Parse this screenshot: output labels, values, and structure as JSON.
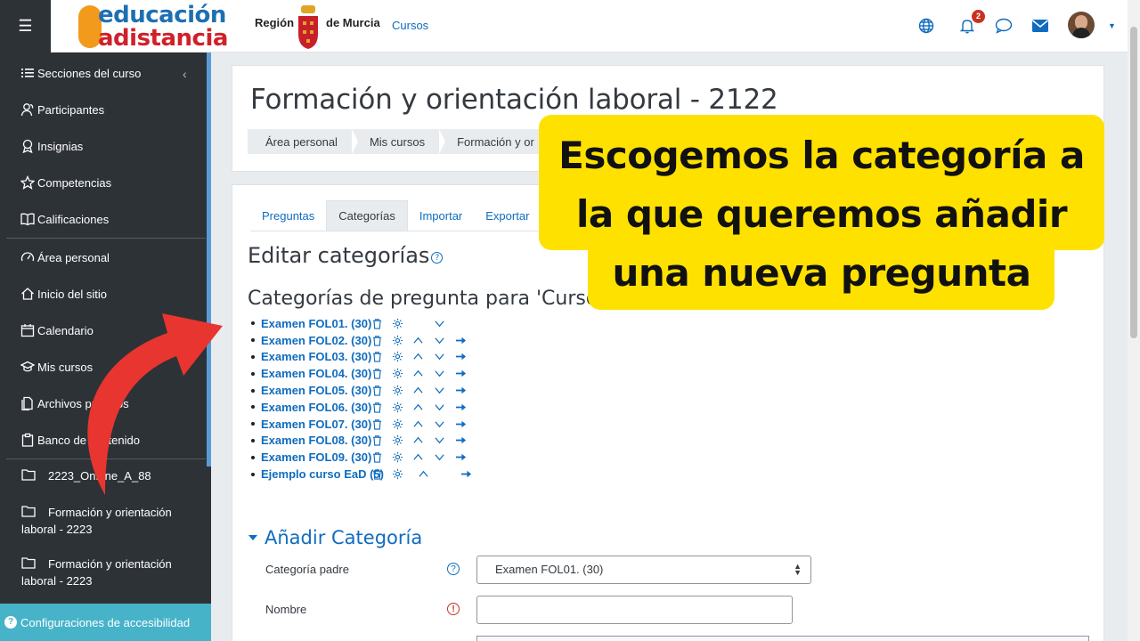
{
  "topbar": {
    "menu_icon": "hamburger-icon",
    "logo_line1": "educación",
    "logo_line2": "adistancia",
    "region_text": "Región",
    "murcia_text": "de Murcia",
    "cursos_link": "Cursos",
    "notification_count": "2",
    "icons": [
      "globe-icon",
      "bell-icon",
      "chat-icon",
      "envelope-icon"
    ]
  },
  "sidebar": {
    "items": [
      {
        "label": "Secciones del curso",
        "icon": "list-icon"
      },
      {
        "label": "Participantes",
        "icon": "users-icon"
      },
      {
        "label": "Insignias",
        "icon": "badge-icon"
      },
      {
        "label": "Competencias",
        "icon": "star-icon"
      },
      {
        "label": "Calificaciones",
        "icon": "gradebook-icon"
      },
      {
        "label": "Área personal",
        "icon": "dashboard-icon"
      },
      {
        "label": "Inicio del sitio",
        "icon": "home-icon"
      },
      {
        "label": "Calendario",
        "icon": "calendar-icon"
      },
      {
        "label": "Mis cursos",
        "icon": "graduation-icon"
      },
      {
        "label": "Archivos privados",
        "icon": "files-icon"
      },
      {
        "label": "Banco de contenido",
        "icon": "clipboard-icon"
      }
    ],
    "courses": [
      {
        "label": "2223_OnLine_A_88"
      },
      {
        "label": "Formación y orientación laboral - 2223"
      },
      {
        "label": "Formación y orientación laboral - 2223"
      }
    ],
    "accessibility": "Configuraciones de accesibilidad"
  },
  "header": {
    "title": "Formación y orientación laboral - 2122",
    "breadcrumb": [
      "Área personal",
      "Mis cursos",
      "Formación y or"
    ]
  },
  "tabs": [
    "Preguntas",
    "Categorías",
    "Importar",
    "Exportar"
  ],
  "main": {
    "edit_heading": "Editar categorías",
    "categories_heading": "Categorías de pregunta para 'Curso: Formación y",
    "categories": [
      {
        "name": "Examen FOL01. (30)"
      },
      {
        "name": "Examen FOL02. (30)"
      },
      {
        "name": "Examen FOL03. (30)"
      },
      {
        "name": "Examen FOL04. (30)"
      },
      {
        "name": "Examen FOL05. (30)"
      },
      {
        "name": "Examen FOL06. (30)"
      },
      {
        "name": "Examen FOL07. (30)"
      },
      {
        "name": "Examen FOL08. (30)"
      },
      {
        "name": "Examen FOL09. (30)"
      },
      {
        "name": "Ejemplo curso EaD (5)"
      }
    ],
    "add_heading": "Añadir Categoría",
    "parent_label": "Categoría padre",
    "parent_value": "Examen FOL01. (30)",
    "name_label": "Nombre"
  },
  "callout": {
    "line1": "Escogemos la categoría a",
    "line2": "la que queremos añadir",
    "line3": "una nueva pregunta"
  },
  "colors": {
    "sidebar_bg": "#2d3237",
    "link": "#0f6cbf",
    "callout_bg": "#ffe100",
    "arrow": "#e8352f",
    "accessibility_bg": "#46b3c9"
  }
}
